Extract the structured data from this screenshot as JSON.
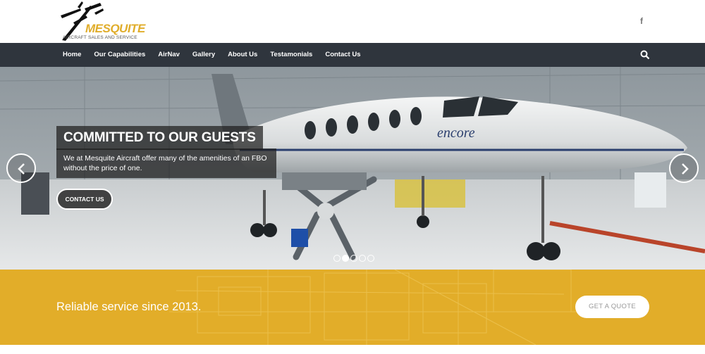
{
  "brand": {
    "name": "MESQUITE",
    "tagline": "AIRCRAFT SALES AND SERVICE",
    "accent_color": "#e2ad29"
  },
  "header": {
    "social_icon": "facebook-icon",
    "social_glyph": "f"
  },
  "nav": {
    "items": [
      {
        "label": "Home"
      },
      {
        "label": "Our Capabilities"
      },
      {
        "label": "AirNav"
      },
      {
        "label": "Gallery"
      },
      {
        "label": "About Us"
      },
      {
        "label": "Testamonials"
      },
      {
        "label": "Contact Us"
      }
    ],
    "search_icon": "search-icon",
    "background": "#2f353d"
  },
  "hero": {
    "title": "COMMITTED TO OUR GUESTS",
    "text": "We at Mesquite Aircraft offer many of the amenities of an FBO without the price of one.",
    "button_label": "CONTACT US",
    "aircraft_livery": "encore",
    "prev_icon": "chevron-left-icon",
    "next_icon": "chevron-right-icon",
    "slides_count": 5,
    "active_slide": 2
  },
  "cta": {
    "text": "Reliable service since 2013.",
    "button_label": "GET A QUOTE"
  }
}
